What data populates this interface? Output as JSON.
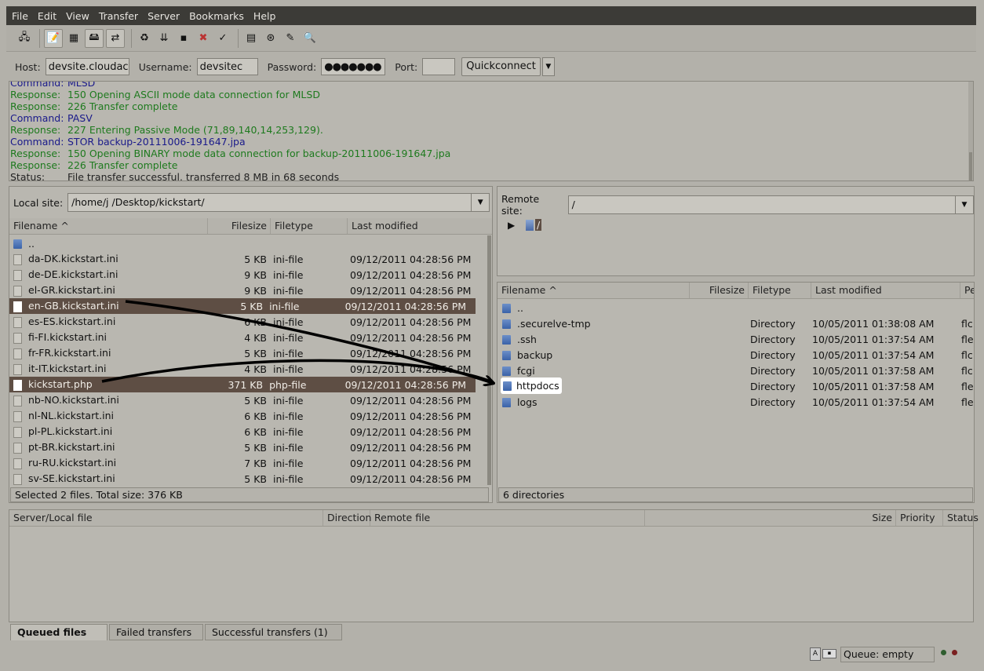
{
  "menu": [
    "File",
    "Edit",
    "View",
    "Transfer",
    "Server",
    "Bookmarks",
    "Help"
  ],
  "toolbar_icons": [
    "site-manager-icon",
    "message-log-icon",
    "directory-tree-icon",
    "remote-tree-icon",
    "queue-icon",
    "refresh-icon",
    "process-queue-icon",
    "cancel-icon",
    "disconnect-icon",
    "reconnect-icon",
    "filter-icon",
    "compare-icon",
    "sync-browse-icon",
    "search-icon"
  ],
  "quickconnect": {
    "host_label": "Host:",
    "host_value": "devsite.cloudacc",
    "user_label": "Username:",
    "user_value": "devsitec",
    "pass_label": "Password:",
    "pass_value": "●●●●●●●",
    "port_label": "Port:",
    "port_value": "",
    "button": "Quickconnect",
    "dropdown_glyph": "▼"
  },
  "log": [
    {
      "type": "command",
      "label": "Command:",
      "text": "MLSD"
    },
    {
      "type": "response",
      "label": "Response:",
      "text": "150 Opening ASCII mode data connection for MLSD"
    },
    {
      "type": "response",
      "label": "Response:",
      "text": "226 Transfer complete"
    },
    {
      "type": "command",
      "label": "Command:",
      "text": "PASV"
    },
    {
      "type": "response",
      "label": "Response:",
      "text": "227 Entering Passive Mode (71,89,140,14,253,129)."
    },
    {
      "type": "command",
      "label": "Command:",
      "text": "STOR backup-20111006-191647.jpa"
    },
    {
      "type": "response",
      "label": "Response:",
      "text": "150 Opening BINARY mode data connection for backup-20111006-191647.jpa"
    },
    {
      "type": "response",
      "label": "Response:",
      "text": "226 Transfer complete"
    },
    {
      "type": "status",
      "label": "Status:",
      "text": "File transfer successful, transferred 8 MB in 68 seconds"
    }
  ],
  "local": {
    "site_label": "Local site:",
    "path": "/home/j   /Desktop/kickstart/",
    "headers": [
      "Filename",
      "Filesize",
      "Filetype",
      "Last modified"
    ],
    "sort_glyph": "^",
    "files": [
      {
        "name": "..",
        "size": "",
        "type": "",
        "modified": "",
        "dir": true,
        "sel": false
      },
      {
        "name": "da-DK.kickstart.ini",
        "size": "5 KB",
        "type": "ini-file",
        "modified": "09/12/2011 04:28:56 PM",
        "sel": false
      },
      {
        "name": "de-DE.kickstart.ini",
        "size": "9 KB",
        "type": "ini-file",
        "modified": "09/12/2011 04:28:56 PM",
        "sel": false
      },
      {
        "name": "el-GR.kickstart.ini",
        "size": "9 KB",
        "type": "ini-file",
        "modified": "09/12/2011 04:28:56 PM",
        "sel": false
      },
      {
        "name": "en-GB.kickstart.ini",
        "size": "5 KB",
        "type": "ini-file",
        "modified": "09/12/2011 04:28:56 PM",
        "sel": true
      },
      {
        "name": "es-ES.kickstart.ini",
        "size": "6 KB",
        "type": "ini-file",
        "modified": "09/12/2011 04:28:56 PM",
        "sel": false
      },
      {
        "name": "fi-FI.kickstart.ini",
        "size": "4 KB",
        "type": "ini-file",
        "modified": "09/12/2011 04:28:56 PM",
        "sel": false
      },
      {
        "name": "fr-FR.kickstart.ini",
        "size": "5 KB",
        "type": "ini-file",
        "modified": "09/12/2011 04:28:56 PM",
        "sel": false
      },
      {
        "name": "it-IT.kickstart.ini",
        "size": "4 KB",
        "type": "ini-file",
        "modified": "09/12/2011 04:28:56 PM",
        "sel": false
      },
      {
        "name": "kickstart.php",
        "size": "371 KB",
        "type": "php-file",
        "modified": "09/12/2011 04:28:56 PM",
        "sel": true
      },
      {
        "name": "nb-NO.kickstart.ini",
        "size": "5 KB",
        "type": "ini-file",
        "modified": "09/12/2011 04:28:56 PM",
        "sel": false
      },
      {
        "name": "nl-NL.kickstart.ini",
        "size": "6 KB",
        "type": "ini-file",
        "modified": "09/12/2011 04:28:56 PM",
        "sel": false
      },
      {
        "name": "pl-PL.kickstart.ini",
        "size": "6 KB",
        "type": "ini-file",
        "modified": "09/12/2011 04:28:56 PM",
        "sel": false
      },
      {
        "name": "pt-BR.kickstart.ini",
        "size": "5 KB",
        "type": "ini-file",
        "modified": "09/12/2011 04:28:56 PM",
        "sel": false
      },
      {
        "name": "ru-RU.kickstart.ini",
        "size": "7 KB",
        "type": "ini-file",
        "modified": "09/12/2011 04:28:56 PM",
        "sel": false
      },
      {
        "name": "sv-SE.kickstart.ini",
        "size": "5 KB",
        "type": "ini-file",
        "modified": "09/12/2011 04:28:56 PM",
        "sel": false
      }
    ],
    "status": "Selected 2 files. Total size: 376 KB"
  },
  "remote": {
    "site_label": "Remote site:",
    "path": "/",
    "tree_root": "/",
    "headers": [
      "Filename",
      "Filesize",
      "Filetype",
      "Last modified",
      "Pe"
    ],
    "sort_glyph": "^",
    "files": [
      {
        "name": "..",
        "size": "",
        "type": "",
        "modified": "",
        "perm": ""
      },
      {
        "name": ".securelve-tmp",
        "size": "",
        "type": "Directory",
        "modified": "10/05/2011 01:38:08 AM",
        "perm": "flc"
      },
      {
        "name": ".ssh",
        "size": "",
        "type": "Directory",
        "modified": "10/05/2011 01:37:54 AM",
        "perm": "fle"
      },
      {
        "name": "backup",
        "size": "",
        "type": "Directory",
        "modified": "10/05/2011 01:37:54 AM",
        "perm": "flc"
      },
      {
        "name": "fcgi",
        "size": "",
        "type": "Directory",
        "modified": "10/05/2011 01:37:58 AM",
        "perm": "flc"
      },
      {
        "name": "httpdocs",
        "size": "",
        "type": "Directory",
        "modified": "10/05/2011 01:37:58 AM",
        "perm": "fle"
      },
      {
        "name": "logs",
        "size": "",
        "type": "Directory",
        "modified": "10/05/2011 01:37:54 AM",
        "perm": "fle"
      }
    ],
    "status": "6 directories"
  },
  "queue": {
    "headers": [
      "Server/Local file",
      "Direction",
      "Remote file",
      "Size",
      "Priority",
      "Status"
    ],
    "tabs": [
      "Queued files",
      "Failed transfers",
      "Successful transfers (1)"
    ],
    "queue_status": "Queue: empty"
  }
}
